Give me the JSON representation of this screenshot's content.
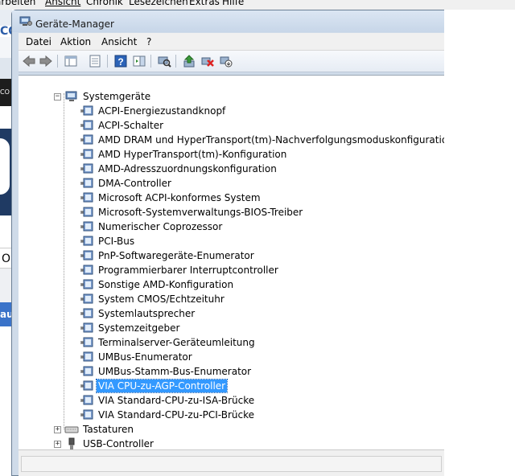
{
  "background": {
    "menu": [
      "arbeiten",
      "Ansicht",
      "Chronik",
      "Lesezeichen",
      "Extras",
      "Hilfe"
    ],
    "side_text": [
      "CO",
      "O",
      "aut"
    ]
  },
  "window": {
    "title": "Geräte-Manager",
    "menu": [
      "Datei",
      "Aktion",
      "Ansicht",
      "?"
    ]
  },
  "toolbar": {
    "icons": [
      "back-icon",
      "forward-icon",
      "console-tree-icon",
      "properties-icon",
      "help-icon",
      "action-pane-icon",
      "scan-hardware-icon",
      "update-driver-icon",
      "uninstall-icon",
      "disable-icon"
    ]
  },
  "tree": {
    "category": "Systemgeräte",
    "items": [
      "ACPI-Energiezustandknopf",
      "ACPI-Schalter",
      "AMD DRAM und HyperTransport(tm)-Nachverfolgungsmoduskonfiguration",
      "AMD HyperTransport(tm)-Konfiguration",
      "AMD-Adresszuordnungskonfiguration",
      "DMA-Controller",
      "Microsoft ACPI-konformes System",
      "Microsoft-Systemverwaltungs-BIOS-Treiber",
      "Numerischer Coprozessor",
      "PCI-Bus",
      "PnP-Softwaregeräte-Enumerator",
      "Programmierbarer Interruptcontroller",
      "Sonstige AMD-Konfiguration",
      "System CMOS/Echtzeituhr",
      "Systemlautsprecher",
      "Systemzeitgeber",
      "Terminalserver-Geräteumleitung",
      "UMBus-Enumerator",
      "UMBus-Stamm-Bus-Enumerator",
      "VIA CPU-zu-AGP-Controller",
      "VIA Standard-CPU-zu-ISA-Brücke",
      "VIA Standard-CPU-zu-PCI-Brücke"
    ],
    "selected_index": 19,
    "other_categories": [
      "Tastaturen",
      "USB-Controller"
    ]
  },
  "colors": {
    "selection": "#3399ff",
    "window_frame": "#cfdbe9"
  }
}
